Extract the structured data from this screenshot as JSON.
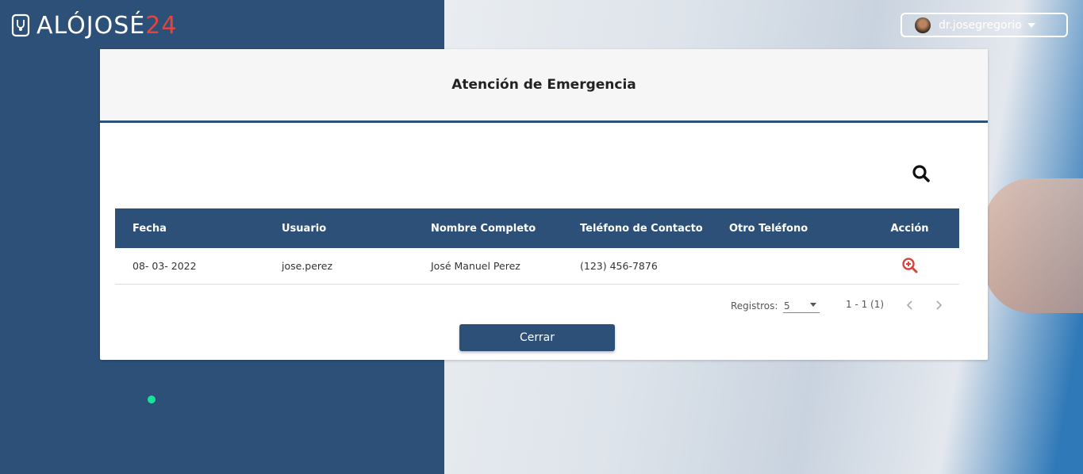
{
  "header": {
    "logo_text": "ALÓJOSÉ",
    "logo_number": "24",
    "user_name": "dr.josegregorio"
  },
  "card": {
    "title": "Atención de Emergencia"
  },
  "table": {
    "headers": [
      "Fecha",
      "Usuario",
      "Nombre Completo",
      "Teléfono de Contacto",
      "Otro Teléfono",
      "Acción"
    ],
    "rows": [
      [
        "08- 03- 2022",
        "jose.perez",
        "José Manuel Perez",
        "(123) 456-7876",
        ""
      ]
    ]
  },
  "paginator": {
    "label": "Registros:",
    "page_size": "5",
    "range": "1 - 1 (1)"
  },
  "buttons": {
    "close_label": "Cerrar"
  },
  "colors": {
    "primary": "#2c5077",
    "accent_red": "#e2443f",
    "status_green": "#19e39a"
  }
}
